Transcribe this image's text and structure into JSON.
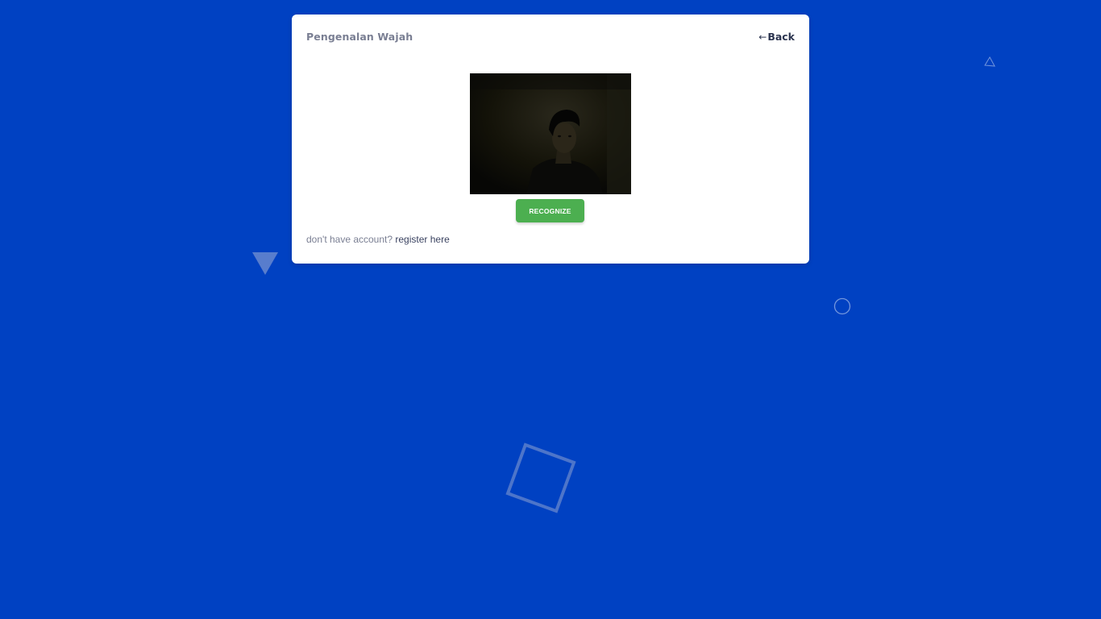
{
  "card": {
    "title": "Pengenalan Wajah",
    "back_arrow": "←",
    "back_label": "Back"
  },
  "recognize_label": "RECOGNIZE",
  "register": {
    "prompt": "don't have account?",
    "link_label": "register here"
  },
  "colors": {
    "background": "#0041C2",
    "button": "#4CAF50"
  }
}
